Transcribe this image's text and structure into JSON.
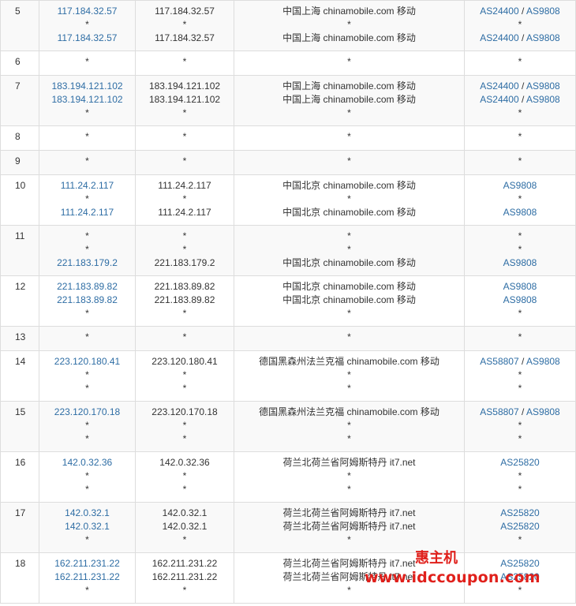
{
  "hops": [
    {
      "n": "5",
      "rows": [
        {
          "ip": "117.184.32.57",
          "host": "117.184.32.57",
          "loc": "中国上海 chinamobile.com 移动",
          "asn": [
            "AS24400",
            "AS9808"
          ]
        },
        {
          "ip": "*",
          "host": "*",
          "loc": "*",
          "asn": [
            "*"
          ]
        },
        {
          "ip": "117.184.32.57",
          "host": "117.184.32.57",
          "loc": "中国上海 chinamobile.com 移动",
          "asn": [
            "AS24400",
            "AS9808"
          ]
        }
      ]
    },
    {
      "n": "6",
      "rows": [
        {
          "ip": "*",
          "host": "*",
          "loc": "*",
          "asn": [
            "*"
          ]
        }
      ]
    },
    {
      "n": "7",
      "rows": [
        {
          "ip": "183.194.121.102",
          "host": "183.194.121.102",
          "loc": "中国上海 chinamobile.com 移动",
          "asn": [
            "AS24400",
            "AS9808"
          ]
        },
        {
          "ip": "183.194.121.102",
          "host": "183.194.121.102",
          "loc": "中国上海 chinamobile.com 移动",
          "asn": [
            "AS24400",
            "AS9808"
          ]
        },
        {
          "ip": "*",
          "host": "*",
          "loc": "*",
          "asn": [
            "*"
          ]
        }
      ]
    },
    {
      "n": "8",
      "rows": [
        {
          "ip": "*",
          "host": "*",
          "loc": "*",
          "asn": [
            "*"
          ]
        }
      ]
    },
    {
      "n": "9",
      "rows": [
        {
          "ip": "*",
          "host": "*",
          "loc": "*",
          "asn": [
            "*"
          ]
        }
      ]
    },
    {
      "n": "10",
      "rows": [
        {
          "ip": "111.24.2.117",
          "host": "111.24.2.117",
          "loc": "中国北京 chinamobile.com 移动",
          "asn": [
            "AS9808"
          ]
        },
        {
          "ip": "*",
          "host": "*",
          "loc": "*",
          "asn": [
            "*"
          ]
        },
        {
          "ip": "111.24.2.117",
          "host": "111.24.2.117",
          "loc": "中国北京 chinamobile.com 移动",
          "asn": [
            "AS9808"
          ]
        }
      ]
    },
    {
      "n": "11",
      "rows": [
        {
          "ip": "*",
          "host": "*",
          "loc": "*",
          "asn": [
            "*"
          ]
        },
        {
          "ip": "*",
          "host": "*",
          "loc": "*",
          "asn": [
            "*"
          ]
        },
        {
          "ip": "221.183.179.2",
          "host": "221.183.179.2",
          "loc": "中国北京 chinamobile.com 移动",
          "asn": [
            "AS9808"
          ]
        }
      ]
    },
    {
      "n": "12",
      "rows": [
        {
          "ip": "221.183.89.82",
          "host": "221.183.89.82",
          "loc": "中国北京 chinamobile.com 移动",
          "asn": [
            "AS9808"
          ]
        },
        {
          "ip": "221.183.89.82",
          "host": "221.183.89.82",
          "loc": "中国北京 chinamobile.com 移动",
          "asn": [
            "AS9808"
          ]
        },
        {
          "ip": "*",
          "host": "*",
          "loc": "*",
          "asn": [
            "*"
          ]
        }
      ]
    },
    {
      "n": "13",
      "rows": [
        {
          "ip": "*",
          "host": "*",
          "loc": "*",
          "asn": [
            "*"
          ]
        }
      ]
    },
    {
      "n": "14",
      "rows": [
        {
          "ip": "223.120.180.41",
          "host": "223.120.180.41",
          "loc": "德国黑森州法兰克福 chinamobile.com 移动",
          "asn": [
            "AS58807",
            "AS9808"
          ]
        },
        {
          "ip": "*",
          "host": "*",
          "loc": "*",
          "asn": [
            "*"
          ]
        },
        {
          "ip": "*",
          "host": "*",
          "loc": "*",
          "asn": [
            "*"
          ]
        }
      ]
    },
    {
      "n": "15",
      "rows": [
        {
          "ip": "223.120.170.18",
          "host": "223.120.170.18",
          "loc": "德国黑森州法兰克福 chinamobile.com 移动",
          "asn": [
            "AS58807",
            "AS9808"
          ]
        },
        {
          "ip": "*",
          "host": "*",
          "loc": "*",
          "asn": [
            "*"
          ]
        },
        {
          "ip": "*",
          "host": "*",
          "loc": "*",
          "asn": [
            "*"
          ]
        }
      ]
    },
    {
      "n": "16",
      "rows": [
        {
          "ip": "142.0.32.36",
          "host": "142.0.32.36",
          "loc": "荷兰北荷兰省阿姆斯特丹 it7.net",
          "asn": [
            "AS25820"
          ]
        },
        {
          "ip": "*",
          "host": "*",
          "loc": "*",
          "asn": [
            "*"
          ]
        },
        {
          "ip": "*",
          "host": "*",
          "loc": "*",
          "asn": [
            "*"
          ]
        }
      ]
    },
    {
      "n": "17",
      "rows": [
        {
          "ip": "142.0.32.1",
          "host": "142.0.32.1",
          "loc": "荷兰北荷兰省阿姆斯特丹 it7.net",
          "asn": [
            "AS25820"
          ]
        },
        {
          "ip": "142.0.32.1",
          "host": "142.0.32.1",
          "loc": "荷兰北荷兰省阿姆斯特丹 it7.net",
          "asn": [
            "AS25820"
          ]
        },
        {
          "ip": "*",
          "host": "*",
          "loc": "*",
          "asn": [
            "*"
          ]
        }
      ]
    },
    {
      "n": "18",
      "rows": [
        {
          "ip": "162.211.231.22",
          "host": "162.211.231.22",
          "loc": "荷兰北荷兰省阿姆斯特丹 it7.net",
          "asn": [
            "AS25820"
          ]
        },
        {
          "ip": "162.211.231.22",
          "host": "162.211.231.22",
          "loc": "荷兰北荷兰省阿姆斯特丹 it7.net",
          "asn": [
            "AS25820"
          ]
        },
        {
          "ip": "*",
          "host": "*",
          "loc": "*",
          "asn": [
            "*"
          ]
        }
      ]
    }
  ],
  "watermark": {
    "brand": "惠主机",
    "url": "www.idccoupon.com"
  },
  "colors": {
    "link": "#2e6da4",
    "border": "#dddddd",
    "watermark": "#e0201b"
  }
}
